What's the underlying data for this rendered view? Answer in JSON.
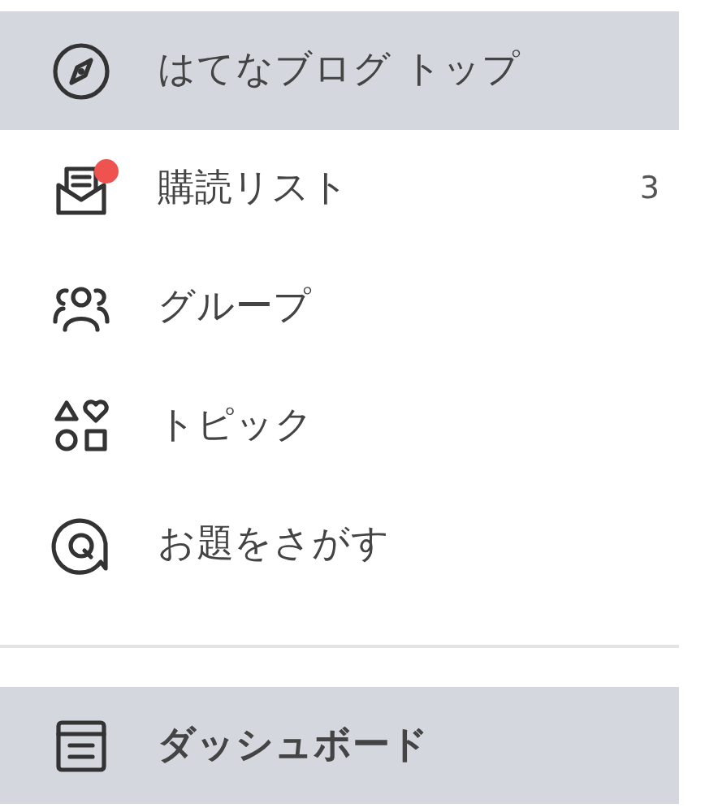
{
  "nav_items": [
    {
      "label": "はてなブログ トップ",
      "selected": true,
      "notification_dot": false
    },
    {
      "label": "購読リスト",
      "selected": false,
      "notification_dot": true,
      "count": "3"
    },
    {
      "label": "グループ",
      "selected": false,
      "notification_dot": false
    },
    {
      "label": "トピック",
      "selected": false,
      "notification_dot": false
    },
    {
      "label": "お題をさがす",
      "selected": false,
      "notification_dot": false
    }
  ],
  "dashboard": {
    "label": "ダッシュボード",
    "selected": true
  }
}
